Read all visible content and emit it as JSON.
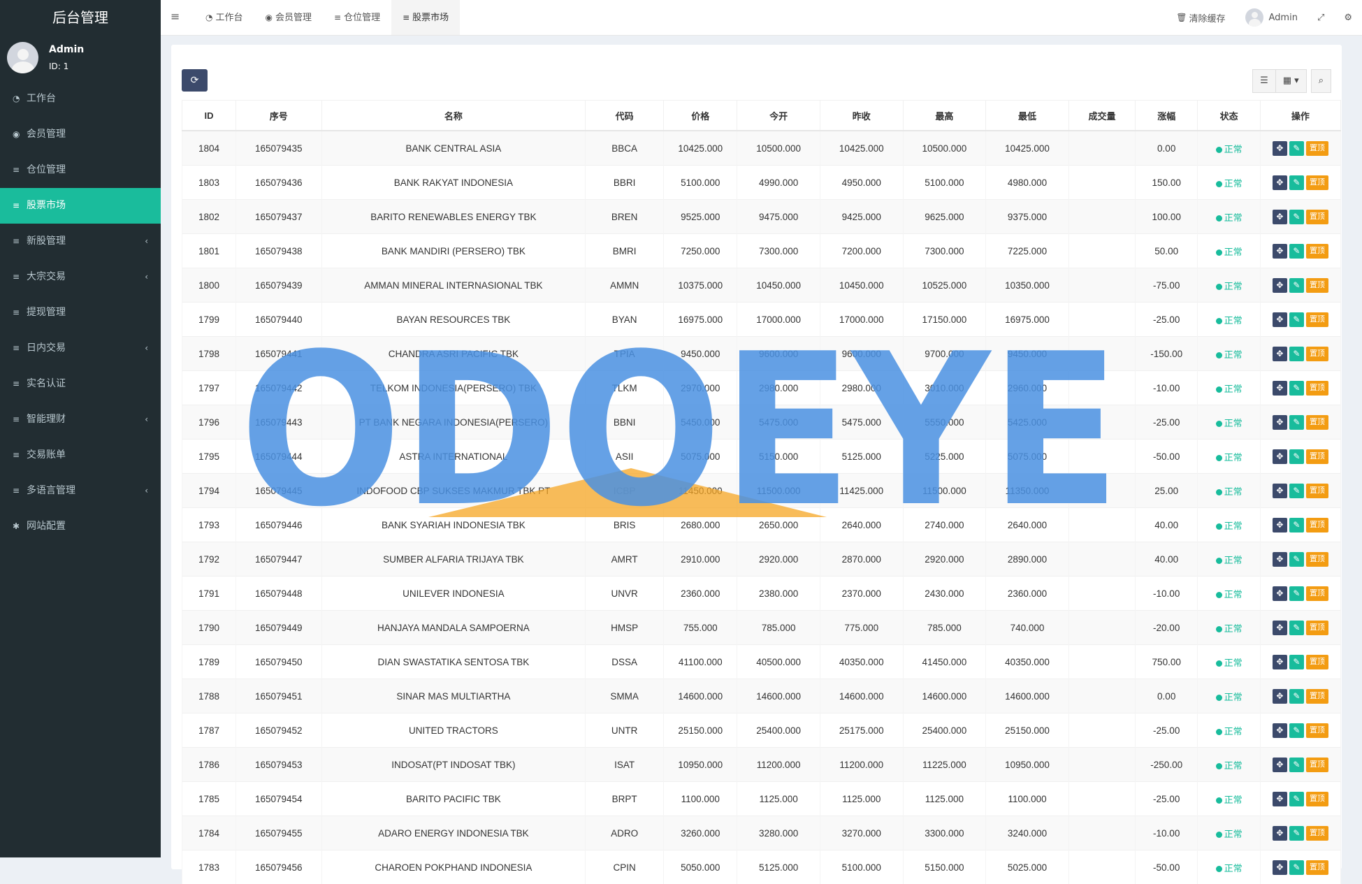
{
  "sidebar": {
    "logo": "后台管理",
    "user": {
      "name": "Admin",
      "id": "ID: 1"
    },
    "items": [
      {
        "label": "工作台",
        "icon": "dashboard-icon",
        "glyph": "◔"
      },
      {
        "label": "会员管理",
        "icon": "user-circle-icon",
        "glyph": "◉"
      },
      {
        "label": "仓位管理",
        "icon": "list-icon",
        "glyph": "≡"
      },
      {
        "label": "股票市场",
        "icon": "list-icon",
        "glyph": "≡",
        "active": true
      },
      {
        "label": "新股管理",
        "icon": "list-icon",
        "glyph": "≡",
        "arrow": "‹"
      },
      {
        "label": "大宗交易",
        "icon": "list-icon",
        "glyph": "≡",
        "arrow": "‹"
      },
      {
        "label": "提现管理",
        "icon": "list-icon",
        "glyph": "≡"
      },
      {
        "label": "日内交易",
        "icon": "list-icon",
        "glyph": "≡",
        "arrow": "‹"
      },
      {
        "label": "实名认证",
        "icon": "list-icon",
        "glyph": "≡"
      },
      {
        "label": "智能理财",
        "icon": "list-icon",
        "glyph": "≡",
        "arrow": "‹"
      },
      {
        "label": "交易账单",
        "icon": "list-icon",
        "glyph": "≡"
      },
      {
        "label": "多语言管理",
        "icon": "list-icon",
        "glyph": "≡",
        "arrow": "‹"
      },
      {
        "label": "网站配置",
        "icon": "gears-icon",
        "glyph": "✱"
      }
    ]
  },
  "topbar": {
    "tabs": [
      {
        "label": "工作台",
        "glyph": "◔"
      },
      {
        "label": "会员管理",
        "glyph": "◉"
      },
      {
        "label": "仓位管理",
        "glyph": "≡"
      },
      {
        "label": "股票市场",
        "glyph": "≡",
        "active": true
      }
    ],
    "clear_cache": "清除缓存",
    "user_name": "Admin"
  },
  "table": {
    "headers": [
      "ID",
      "序号",
      "名称",
      "代码",
      "价格",
      "今开",
      "昨收",
      "最高",
      "最低",
      "成交量",
      "涨幅",
      "状态",
      "操作"
    ],
    "status_label": "正常",
    "top_label": "置顶",
    "rows": [
      [
        "1804",
        "165079435",
        "BANK CENTRAL ASIA",
        "BBCA",
        "10425.000",
        "10500.000",
        "10425.000",
        "10500.000",
        "10425.000",
        "",
        "0.00"
      ],
      [
        "1803",
        "165079436",
        "BANK RAKYAT INDONESIA",
        "BBRI",
        "5100.000",
        "4990.000",
        "4950.000",
        "5100.000",
        "4980.000",
        "",
        "150.00"
      ],
      [
        "1802",
        "165079437",
        "BARITO RENEWABLES ENERGY TBK",
        "BREN",
        "9525.000",
        "9475.000",
        "9425.000",
        "9625.000",
        "9375.000",
        "",
        "100.00"
      ],
      [
        "1801",
        "165079438",
        "BANK MANDIRI (PERSERO) TBK",
        "BMRI",
        "7250.000",
        "7300.000",
        "7200.000",
        "7300.000",
        "7225.000",
        "",
        "50.00"
      ],
      [
        "1800",
        "165079439",
        "AMMAN MINERAL INTERNASIONAL TBK",
        "AMMN",
        "10375.000",
        "10450.000",
        "10450.000",
        "10525.000",
        "10350.000",
        "",
        "-75.00"
      ],
      [
        "1799",
        "165079440",
        "BAYAN RESOURCES TBK",
        "BYAN",
        "16975.000",
        "17000.000",
        "17000.000",
        "17150.000",
        "16975.000",
        "",
        "-25.00"
      ],
      [
        "1798",
        "165079441",
        "CHANDRA ASRI PACIFIC TBK",
        "TPIA",
        "9450.000",
        "9600.000",
        "9600.000",
        "9700.000",
        "9450.000",
        "",
        "-150.00"
      ],
      [
        "1797",
        "165079442",
        "TELKOM INDONESIA(PERSERO) TBK",
        "TLKM",
        "2970.000",
        "2980.000",
        "2980.000",
        "3010.000",
        "2960.000",
        "",
        "-10.00"
      ],
      [
        "1796",
        "165079443",
        "PT BANK NEGARA INDONESIA(PERSERO)",
        "BBNI",
        "5450.000",
        "5475.000",
        "5475.000",
        "5550.000",
        "5425.000",
        "",
        "-25.00"
      ],
      [
        "1795",
        "165079444",
        "ASTRA INTERNATIONAL",
        "ASII",
        "5075.000",
        "5150.000",
        "5125.000",
        "5225.000",
        "5075.000",
        "",
        "-50.00"
      ],
      [
        "1794",
        "165079445",
        "INDOFOOD CBP SUKSES MAKMUR TBK PT",
        "ICBP",
        "11450.000",
        "11500.000",
        "11425.000",
        "11500.000",
        "11350.000",
        "",
        "25.00"
      ],
      [
        "1793",
        "165079446",
        "BANK SYARIAH INDONESIA TBK",
        "BRIS",
        "2680.000",
        "2650.000",
        "2640.000",
        "2740.000",
        "2640.000",
        "",
        "40.00"
      ],
      [
        "1792",
        "165079447",
        "SUMBER ALFARIA TRIJAYA TBK",
        "AMRT",
        "2910.000",
        "2920.000",
        "2870.000",
        "2920.000",
        "2890.000",
        "",
        "40.00"
      ],
      [
        "1791",
        "165079448",
        "UNILEVER INDONESIA",
        "UNVR",
        "2360.000",
        "2380.000",
        "2370.000",
        "2430.000",
        "2360.000",
        "",
        "-10.00"
      ],
      [
        "1790",
        "165079449",
        "HANJAYA MANDALA SAMPOERNA",
        "HMSP",
        "755.000",
        "785.000",
        "775.000",
        "785.000",
        "740.000",
        "",
        "-20.00"
      ],
      [
        "1789",
        "165079450",
        "DIAN SWASTATIKA SENTOSA TBK",
        "DSSA",
        "41100.000",
        "40500.000",
        "40350.000",
        "41450.000",
        "40350.000",
        "",
        "750.00"
      ],
      [
        "1788",
        "165079451",
        "SINAR MAS MULTIARTHA",
        "SMMA",
        "14600.000",
        "14600.000",
        "14600.000",
        "14600.000",
        "14600.000",
        "",
        "0.00"
      ],
      [
        "1787",
        "165079452",
        "UNITED TRACTORS",
        "UNTR",
        "25150.000",
        "25400.000",
        "25175.000",
        "25400.000",
        "25150.000",
        "",
        "-25.00"
      ],
      [
        "1786",
        "165079453",
        "INDOSAT(PT INDOSAT TBK)",
        "ISAT",
        "10950.000",
        "11200.000",
        "11200.000",
        "11225.000",
        "10950.000",
        "",
        "-250.00"
      ],
      [
        "1785",
        "165079454",
        "BARITO PACIFIC TBK",
        "BRPT",
        "1100.000",
        "1125.000",
        "1125.000",
        "1125.000",
        "1100.000",
        "",
        "-25.00"
      ],
      [
        "1784",
        "165079455",
        "ADARO ENERGY INDONESIA TBK",
        "ADRO",
        "3260.000",
        "3280.000",
        "3270.000",
        "3300.000",
        "3240.000",
        "",
        "-10.00"
      ],
      [
        "1783",
        "165079456",
        "CHAROEN POKPHAND INDONESIA",
        "CPIN",
        "5050.000",
        "5125.000",
        "5100.000",
        "5150.000",
        "5025.000",
        "",
        "-50.00"
      ]
    ]
  },
  "watermark": {
    "text": "ODOEYE",
    "color": "#4a90e2",
    "accent": "#f5a623"
  }
}
